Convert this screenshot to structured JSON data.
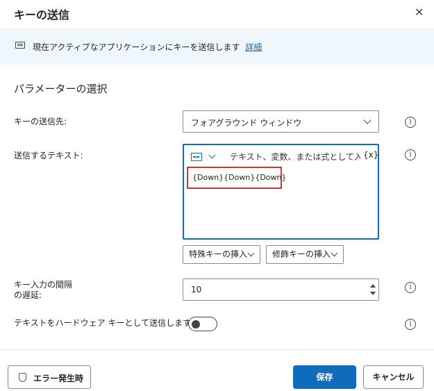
{
  "dialog": {
    "title": "キーの送信",
    "close_icon": "close-icon"
  },
  "banner": {
    "icon": "keyboard-icon",
    "message": "現在アクティブなアプリケーションにキーを送信します",
    "link": "詳細"
  },
  "section": {
    "title": "パラメーターの選択"
  },
  "fields": {
    "target": {
      "label": "キーの送信先:",
      "value": "フォアグラウンド ウィンドウ"
    },
    "text": {
      "label": "送信するテキスト:",
      "placeholder": "テキスト、変数、または式として入力しま",
      "variable_icon": "{x}",
      "value": "{Down}{Down}{Down}",
      "special_key_button": "特殊キーの挿入",
      "modifier_key_button": "修飾キーの挿入"
    },
    "delay": {
      "label_line1": "キー入力の間隔",
      "label_line2": "の遅延:",
      "value": "10"
    },
    "hardware": {
      "label": "テキストをハードウェア キーとして送信します:",
      "enabled": false
    }
  },
  "footer": {
    "on_error": "エラー発生時",
    "save": "保存",
    "cancel": "キャンセル"
  },
  "colors": {
    "accent": "#0f6cbd",
    "highlight": "#d13438",
    "banner_bg": "#eff6fc"
  }
}
